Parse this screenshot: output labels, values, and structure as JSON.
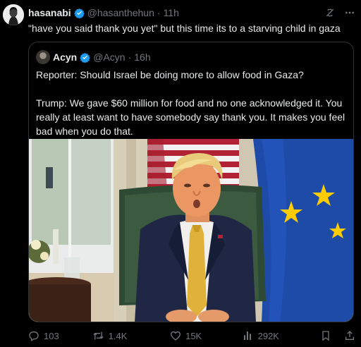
{
  "tweet": {
    "name": "hasanabi",
    "handle": "@hasanthehun",
    "separator": "·",
    "time": "11h",
    "text": "\"have you said thank you yet\" but this time its to a starving child in gaza"
  },
  "quote": {
    "name": "Acyn",
    "handle": "@Acyn",
    "separator": "·",
    "time": "16h",
    "paragraphs": [
      "Reporter: Should Israel be doing more to allow food in Gaza?",
      "Trump: We gave $60 million for food and no one acknowledged it. You really at least want to have somebody say thank you. It makes you feel bad when you do that."
    ]
  },
  "actions": {
    "replies": "103",
    "reposts": "1.4K",
    "likes": "15K",
    "views": "292K"
  },
  "colors": {
    "background": "#000000",
    "text": "#e7e9ea",
    "muted": "#71767b",
    "verified": "#1d9bf0",
    "border": "#2f3336"
  },
  "icons": [
    "verified-badge-icon",
    "grok-icon",
    "more-icon",
    "reply-icon",
    "repost-icon",
    "like-icon",
    "views-icon",
    "bookmark-icon",
    "share-icon"
  ]
}
